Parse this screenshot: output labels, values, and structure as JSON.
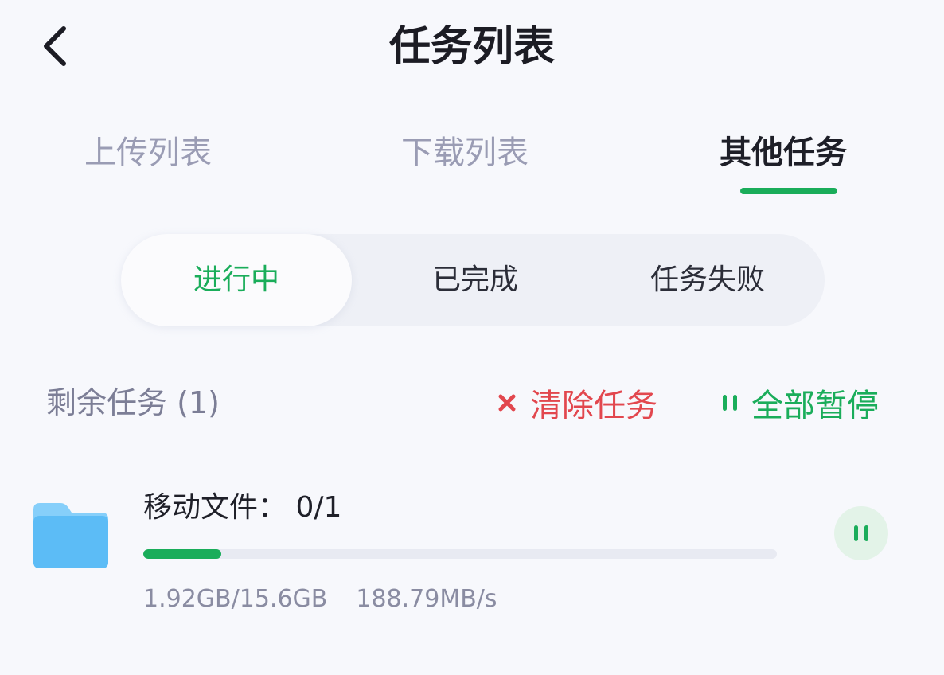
{
  "header": {
    "title": "任务列表",
    "back_icon": "chevron-left-icon"
  },
  "tabs": [
    {
      "label": "上传列表",
      "active": false
    },
    {
      "label": "下载列表",
      "active": false
    },
    {
      "label": "其他任务",
      "active": true
    }
  ],
  "segments": [
    {
      "label": "进行中",
      "active": true
    },
    {
      "label": "已完成",
      "active": false
    },
    {
      "label": "任务失败",
      "active": false
    }
  ],
  "toolbar": {
    "remaining_label": "剩余任务 (1)",
    "clear_label": "清除任务",
    "clear_icon": "close-icon",
    "pause_all_label": "全部暂停",
    "pause_all_icon": "pause-icon"
  },
  "task": {
    "name": "移动文件： 0/1",
    "icon": "folder-icon",
    "progress_fraction": 0.123,
    "size_text": "1.92GB/15.6GB",
    "speed_text": "188.79MB/s",
    "pause_icon": "pause-icon"
  },
  "colors": {
    "accent_green": "#1aad5a",
    "active_tab_underline": "#1aad5a",
    "danger_red": "#e2474e",
    "folder_blue": "#5cbcf6"
  }
}
